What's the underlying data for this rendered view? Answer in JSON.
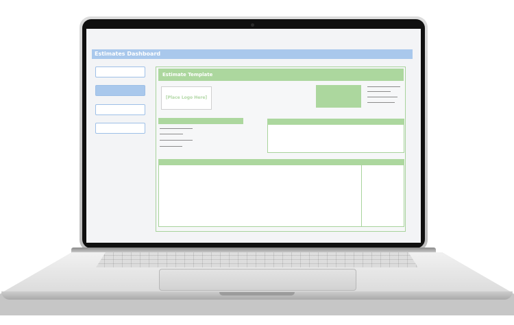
{
  "app": {
    "title": "Estimates Dashboard"
  },
  "sidebar": {
    "items": [
      {
        "active": false
      },
      {
        "active": true
      },
      {
        "active": false
      },
      {
        "active": false
      }
    ]
  },
  "template": {
    "title": "Estimate Template",
    "logo_placeholder": "[Place Logo Here]"
  },
  "colors": {
    "header_blue": "#a9c8ec",
    "accent_green": "#acd79e",
    "device_silver": "#c6c6c6",
    "bezel": "#101010"
  }
}
